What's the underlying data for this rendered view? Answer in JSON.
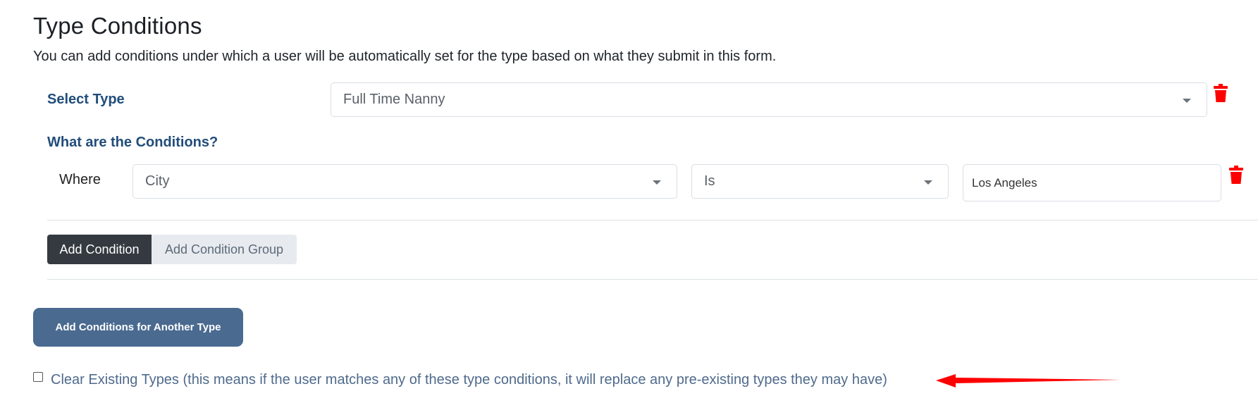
{
  "section": {
    "title": "Type Conditions",
    "description": "You can add conditions under which a user will be automatically set for the type based on what they submit in this form."
  },
  "type_group": {
    "select_type_label": "Select Type",
    "select_type_value": "Full Time Nanny",
    "conditions_label": "What are the Conditions?",
    "condition": {
      "where_label": "Where",
      "field_value": "City",
      "operator_value": "Is",
      "text_value": "Los Angeles"
    },
    "add_condition_label": "Add Condition",
    "add_condition_group_label": "Add Condition Group"
  },
  "add_another_type_label": "Add Conditions for Another Type",
  "clear_existing": {
    "label": "Clear Existing Types (this means if the user matches any of these type conditions, it will replace any pre-existing types they may have)",
    "checked": false
  },
  "colors": {
    "accent_blue": "#214d7a",
    "primary_button": "#4a6a90",
    "dark_button": "#343a40",
    "delete_red": "#ff0000",
    "annotation_arrow": "#ff0000"
  },
  "icons": {
    "delete": "trash-icon",
    "dropdown": "chevron-down-icon"
  }
}
